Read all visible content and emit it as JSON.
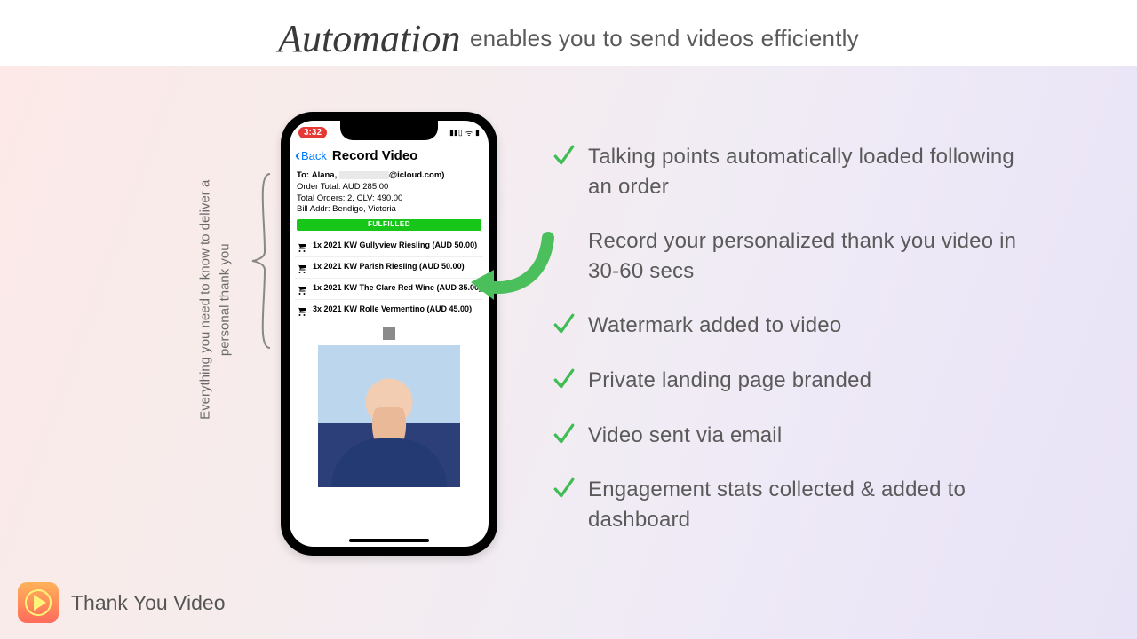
{
  "header": {
    "script": "Automation",
    "plain": "enables you to send videos efficiently"
  },
  "caption": "Everything you need to know to deliver a personal thank you",
  "phone": {
    "time": "3:32",
    "back": "Back",
    "title": "Record Video",
    "to_label": "To:",
    "to_name": "Alana,",
    "to_domain": "@icloud.com)",
    "order_total": "Order Total: AUD 285.00",
    "total_orders": "Total Orders: 2, CLV: 490.00",
    "bill_addr": "Bill Addr: Bendigo, Victoria",
    "fulfilled": "FULFILLED",
    "items": [
      "1x 2021 KW Gullyview Riesling (AUD 50.00)",
      "1x 2021 KW Parish Riesling (AUD 50.00)",
      "1x 2021 KW The Clare Red Wine (AUD 35.00)",
      "3x 2021 KW Rolle Vermentino (AUD 45.00)"
    ]
  },
  "features": [
    {
      "check": true,
      "text": "Talking points automatically loaded following an order"
    },
    {
      "check": false,
      "text": "Record your personalized thank you video in 30-60 secs"
    },
    {
      "check": true,
      "text": "Watermark added to video"
    },
    {
      "check": true,
      "text": "Private landing page branded"
    },
    {
      "check": true,
      "text": "Video sent via email"
    },
    {
      "check": true,
      "text": "Engagement stats collected & added to dashboard"
    }
  ],
  "brand": "Thank You Video"
}
